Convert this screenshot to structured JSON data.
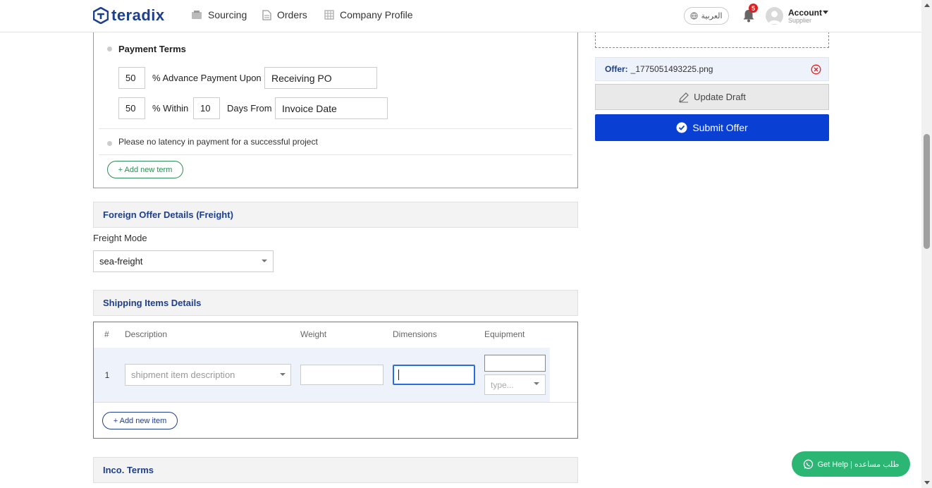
{
  "header": {
    "logo_text": "teradix",
    "nav": [
      {
        "label": "Sourcing",
        "icon": "sourcing-icon"
      },
      {
        "label": "Orders",
        "icon": "document-icon"
      },
      {
        "label": "Company Profile",
        "icon": "company-icon"
      }
    ],
    "language_label": "العربية",
    "notification_count": "5",
    "account": {
      "title": "Account",
      "subtitle": "Supplier"
    }
  },
  "payment_terms": {
    "title": "Payment Terms",
    "row1": {
      "percent": "50",
      "label": "% Advance Payment Upon",
      "value": "Receiving PO"
    },
    "row2": {
      "percent": "50",
      "within_label": "% Within",
      "days": "10",
      "days_label": "Days From",
      "value": "Invoice Date"
    },
    "note": "Please no latency in payment for a successful project",
    "add_term_label": "+ Add new term"
  },
  "freight": {
    "section_title": "Foreign Offer Details (Freight)",
    "mode_label": "Freight Mode",
    "mode_value": "sea-freight"
  },
  "shipping": {
    "section_title": "Shipping Items Details",
    "columns": [
      "#",
      "Description",
      "Weight",
      "Dimensions",
      "Equipment"
    ],
    "rows": [
      {
        "index": "1",
        "description_placeholder": "shipment item description",
        "weight": "",
        "dimensions": "",
        "equipment_placeholder": "type..."
      }
    ],
    "add_item_label": "+ Add new item"
  },
  "inco_terms": {
    "section_title": "Inco. Terms"
  },
  "right_panel": {
    "offer_file_label": "Offer:",
    "offer_file_name": "_1775051493225.png",
    "update_label": "Update Draft",
    "submit_label": "Submit Offer"
  },
  "help": {
    "label": "Get Help | طلب مساعده"
  },
  "colors": {
    "brand": "#1d3f8e",
    "submit": "#0a3fd4",
    "help": "#2bb673",
    "add_term": "#2e8b57",
    "badge": "#e02020"
  }
}
